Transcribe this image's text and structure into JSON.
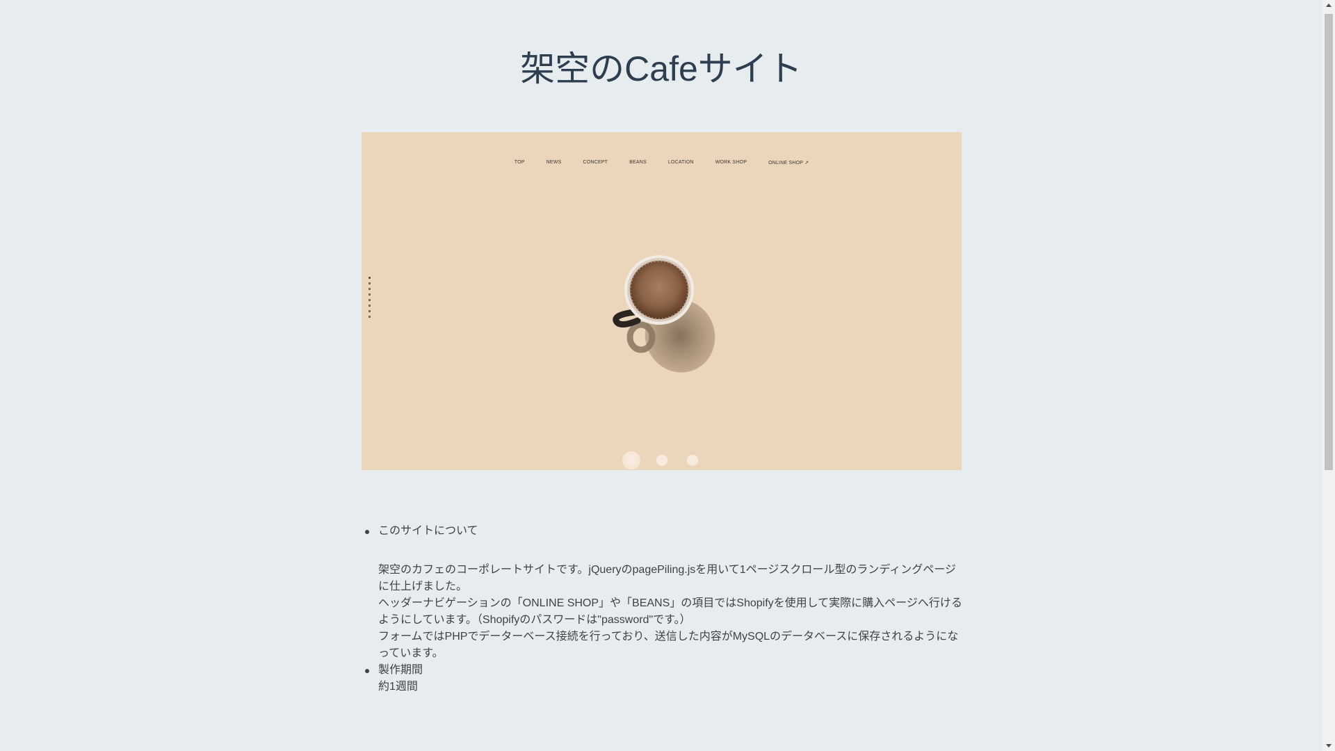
{
  "page": {
    "title": "架空のCafeサイト"
  },
  "slider": {
    "nav": [
      "TOP",
      "NEWS",
      "CONCEPT",
      "BEANS",
      "LOCATION",
      "WORK SHOP",
      "ONLINE SHOP"
    ],
    "side_dots_count": 8,
    "slide_count": 3,
    "active_slide": 1
  },
  "about": {
    "heading": "このサイトについて",
    "lines": [
      "架空のカフェのコーポレートサイトです。jQueryのpagePiling.jsを用いて1ページスクロール型のランディングページに仕上げました。",
      "ヘッダーナビゲーションの「ONLINE SHOP」や「BEANS」の項目ではShopifyを使用して実際に購入ページへ行けるようにしています。（Shopifyのパスワードは\"password\"です。）",
      "フォームではPHPでデーターベース接続を行っており、送信した内容がMySQLのデータベースに保存されるようになっています。"
    ]
  },
  "period": {
    "heading": "製作期間",
    "body": "約1週間"
  },
  "colors": {
    "background": "#e7edee",
    "slide_bg": "#ecd6bb",
    "title": "#2c3e50"
  }
}
